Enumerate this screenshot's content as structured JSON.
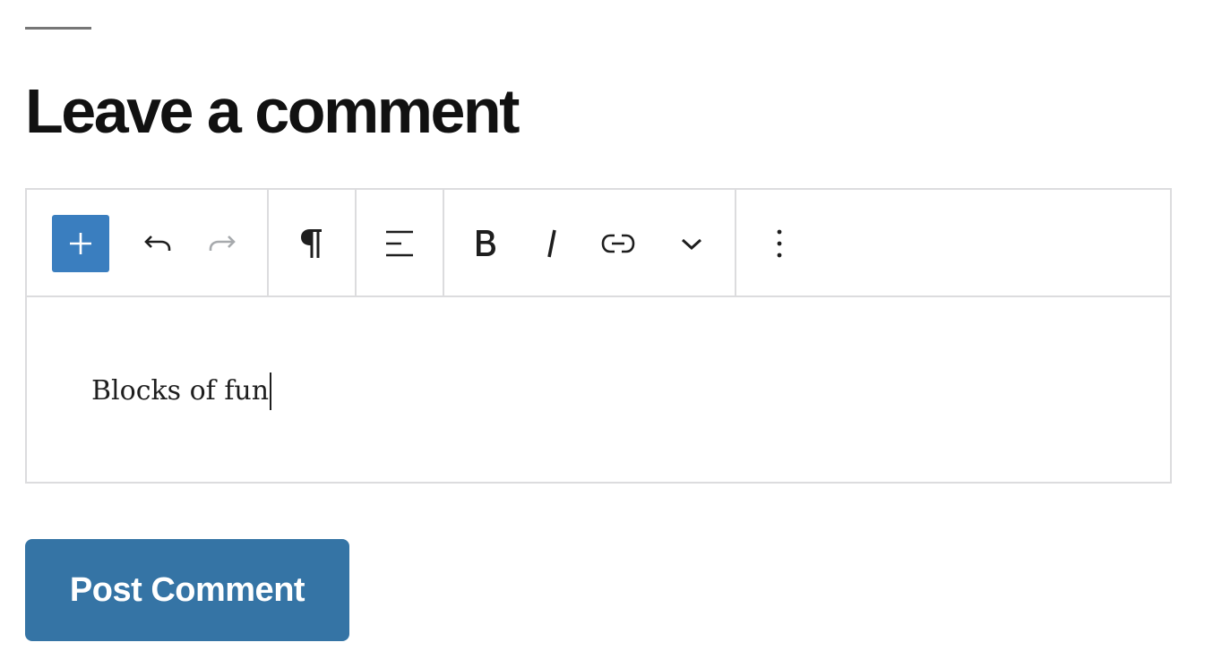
{
  "comment_form": {
    "title": "Leave a comment",
    "submit_label": "Post Comment"
  },
  "editor": {
    "content": "Blocks of fun",
    "toolbar": {
      "tools": [
        {
          "name": "add-block",
          "icon": "plus-icon",
          "enabled": true
        },
        {
          "name": "undo",
          "icon": "undo-icon",
          "enabled": true
        },
        {
          "name": "redo",
          "icon": "redo-icon",
          "enabled": false
        },
        {
          "name": "block-type-paragraph",
          "icon": "pilcrow-icon",
          "enabled": true
        },
        {
          "name": "align",
          "icon": "align-left-icon",
          "enabled": true
        },
        {
          "name": "bold",
          "icon": "bold-icon",
          "enabled": true
        },
        {
          "name": "italic",
          "icon": "italic-icon",
          "enabled": true
        },
        {
          "name": "link",
          "icon": "link-icon",
          "enabled": true
        },
        {
          "name": "more-formatting",
          "icon": "chevron-down-icon",
          "enabled": true
        },
        {
          "name": "options",
          "icon": "more-vertical-icon",
          "enabled": true
        }
      ]
    }
  },
  "colors": {
    "accent": "#3a7ebf",
    "button": "#3574a5",
    "text": "#111111",
    "border": "#dcdcde",
    "disabled_icon": "#a7aaad"
  }
}
